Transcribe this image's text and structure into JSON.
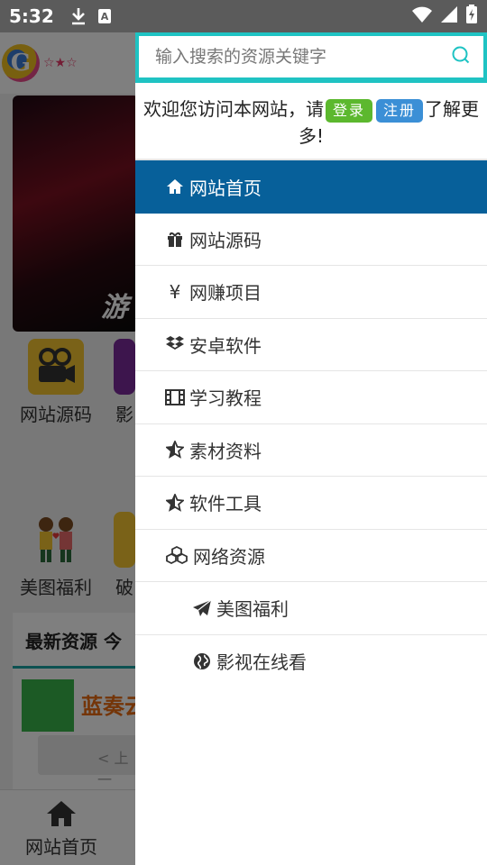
{
  "status": {
    "time": "5:32",
    "icons": [
      "download-icon",
      "keyboard-a-icon",
      "wifi-icon",
      "signal-icon",
      "battery-charging-icon"
    ]
  },
  "background": {
    "banner_text": "游",
    "categories": [
      {
        "label": "网站源码",
        "icon": "video-camera-icon",
        "color": "#f4c430"
      },
      {
        "label": "影",
        "icon": "purple-tile-icon",
        "color": "#7a2a9a"
      },
      {
        "label": "美图福利",
        "icon": "couple-icon",
        "color": "#f0f0f0"
      },
      {
        "label": "破",
        "icon": "yellow-tile-icon",
        "color": "#f4c430"
      }
    ],
    "latest_title": "最新资源 今",
    "card_title": "蓝奏云",
    "pager_text": "< 上一",
    "tab_label": "网站首页"
  },
  "drawer": {
    "search_placeholder": "输入搜索的资源关键字",
    "welcome_before": "欢迎您访问本网站，请",
    "login_label": "登录",
    "register_label": "注册",
    "welcome_after": "了解更多!",
    "menu": [
      {
        "label": "网站首页",
        "icon": "home-icon",
        "active": true
      },
      {
        "label": "网站源码",
        "icon": "gift-icon"
      },
      {
        "label": "网赚项目",
        "icon": "yen-icon"
      },
      {
        "label": "安卓软件",
        "icon": "dropbox-icon"
      },
      {
        "label": "学习教程",
        "icon": "film-icon"
      },
      {
        "label": "素材资料",
        "icon": "star-half-icon"
      },
      {
        "label": "软件工具",
        "icon": "star-half-icon"
      },
      {
        "label": "网络资源",
        "icon": "cubes-icon"
      },
      {
        "label": "美图福利",
        "icon": "paper-plane-icon",
        "sub": true
      },
      {
        "label": "影视在线看",
        "icon": "globe-icon",
        "sub": true
      }
    ]
  },
  "colors": {
    "accent_teal": "#1fc3c3",
    "active_blue": "#07609a",
    "login_green": "#5cb82e",
    "register_blue": "#3b8fd6"
  }
}
